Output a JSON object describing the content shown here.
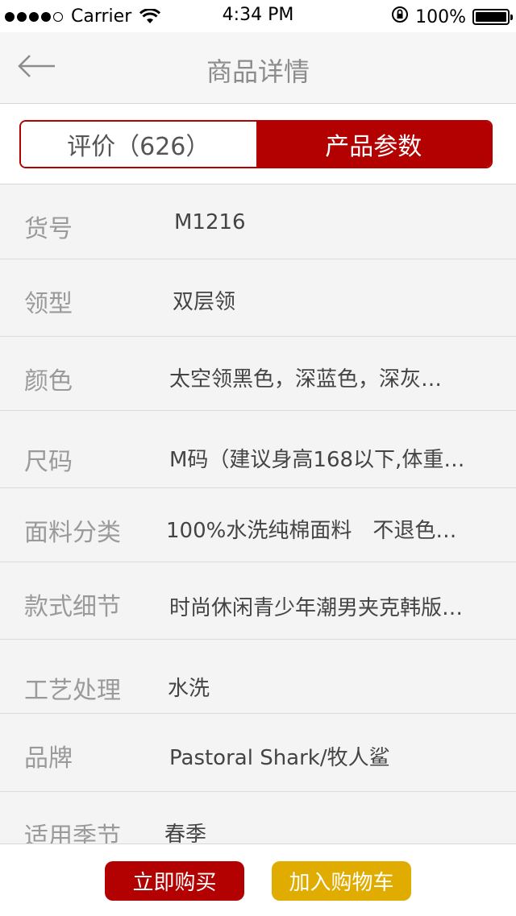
{
  "status_bar": {
    "carrier": "Carrier",
    "time": "4:34 PM",
    "battery": "100%"
  },
  "nav": {
    "title": "商品详情",
    "back_icon": "back-arrow-icon"
  },
  "segments": {
    "reviews_label": "评价（626）",
    "params_label": "产品参数",
    "active": "params"
  },
  "params": [
    {
      "label": "货号",
      "value": "M1216"
    },
    {
      "label": "领型",
      "value": "双层领"
    },
    {
      "label": "颜色",
      "value": "太空领黑色，深蓝色，深灰…"
    },
    {
      "label": "尺码",
      "value": "M码（建议身高168以下,体重…"
    },
    {
      "label": "面料分类",
      "value": "100%水洗纯棉面料　不退色…"
    },
    {
      "label": "款式细节",
      "value": "时尚休闲青少年潮男夹克韩版…"
    },
    {
      "label": "工艺处理",
      "value": "水洗"
    },
    {
      "label": "品牌",
      "value": "Pastoral Shark/牧人鲨"
    },
    {
      "label": "适用季节",
      "value": "春季"
    }
  ],
  "actions": {
    "buy_label": "立即购买",
    "cart_label": "加入购物车"
  },
  "colors": {
    "accent_red": "#b30000",
    "accent_yellow": "#e1ac00"
  }
}
